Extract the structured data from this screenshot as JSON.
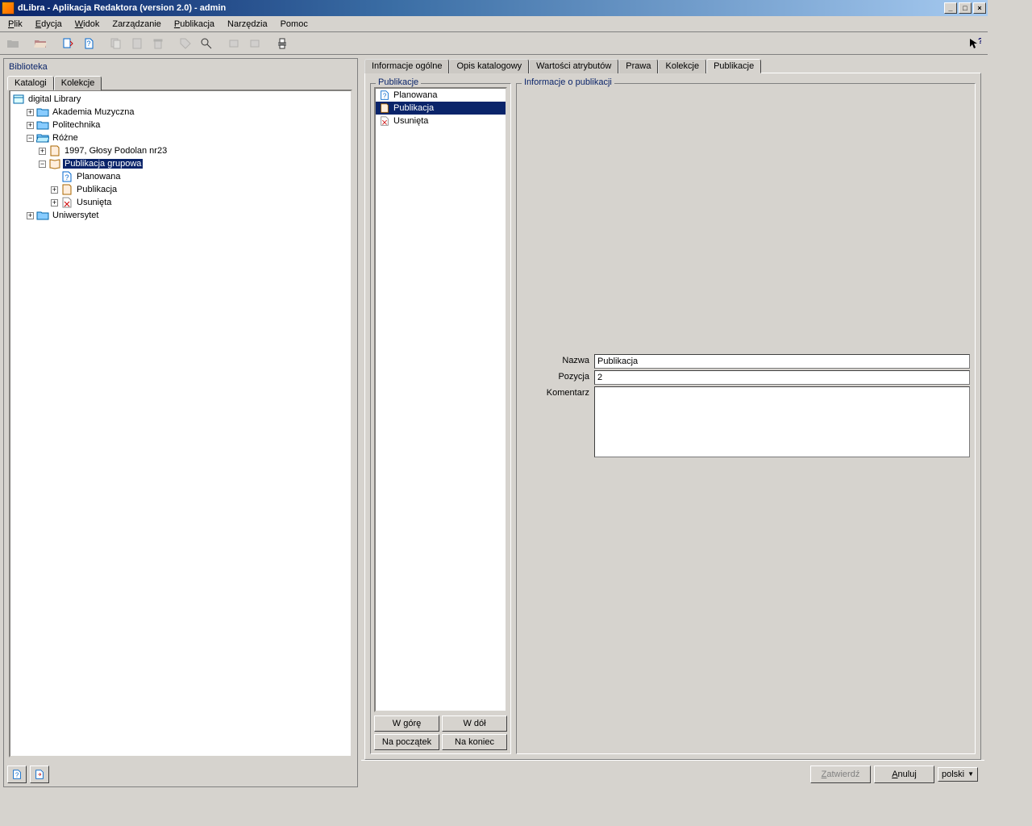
{
  "window": {
    "title": "dLibra - Aplikacja Redaktora (version 2.0) - admin"
  },
  "menu": {
    "file": "Plik",
    "edit": "Edycja",
    "view": "Widok",
    "manage": "Zarządzanie",
    "publication": "Publikacja",
    "tools": "Narzędzia",
    "help": "Pomoc"
  },
  "left": {
    "header": "Biblioteka",
    "tabs": {
      "catalogs": "Katalogi",
      "collections": "Kolekcje"
    },
    "tree": {
      "root": "digital Library",
      "n1": "Akademia Muzyczna",
      "n2": "Politechnika",
      "n3": "Różne",
      "n3a": "1997, Głosy Podolan nr23",
      "n3b": "Publikacja grupowa",
      "n3b1": "Planowana",
      "n3b2": "Publikacja",
      "n3b3": "Usunięta",
      "n4": "Uniwersytet"
    }
  },
  "right": {
    "tabs": {
      "t1": "Informacje ogólne",
      "t2": "Opis katalogowy",
      "t3": "Wartości atrybutów",
      "t4": "Prawa",
      "t5": "Kolekcje",
      "t6": "Publikacje"
    },
    "pub_group_title": "Publikacje",
    "info_group_title": "Informacje o publikacji",
    "pub_list": {
      "p1": "Planowana",
      "p2": "Publikacja",
      "p3": "Usunięta"
    },
    "buttons": {
      "up": "W górę",
      "down": "W dół",
      "start": "Na początek",
      "end": "Na koniec"
    },
    "fields": {
      "name_label": "Nazwa",
      "name_value": "Publikacja",
      "pos_label": "Pozycja",
      "pos_value": "2",
      "comment_label": "Komentarz",
      "comment_value": ""
    }
  },
  "footer": {
    "confirm": "Zatwierdź",
    "cancel": "Anuluj",
    "lang": "polski"
  }
}
